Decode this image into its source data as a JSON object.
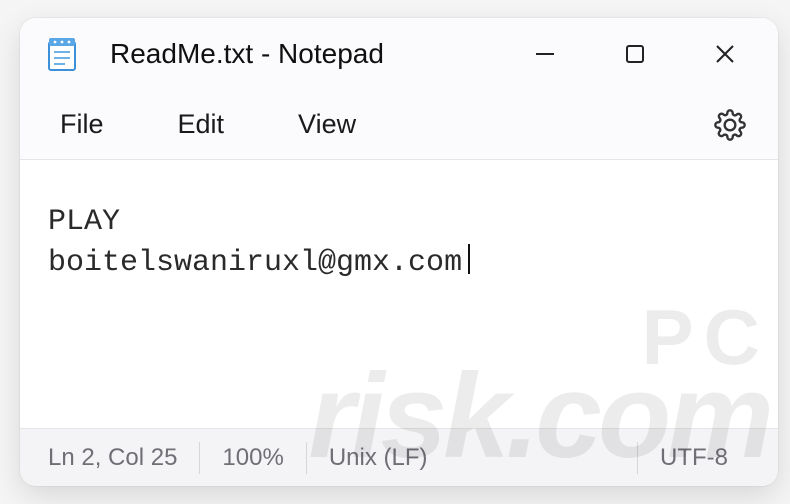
{
  "window": {
    "title": "ReadMe.txt - Notepad"
  },
  "menubar": {
    "items": [
      "File",
      "Edit",
      "View"
    ]
  },
  "editor": {
    "lines": [
      "PLAY",
      "boitelswaniruxl@gmx.com"
    ]
  },
  "statusbar": {
    "position": "Ln 2, Col 25",
    "zoom": "100%",
    "line_ending": "Unix (LF)",
    "encoding": "UTF-8"
  },
  "icons": {
    "app": "notepad-icon",
    "minimize": "minimize-icon",
    "maximize": "maximize-icon",
    "close": "close-icon",
    "settings": "gear-icon"
  },
  "watermark": {
    "line1": "PC",
    "line2": "risk.com"
  }
}
